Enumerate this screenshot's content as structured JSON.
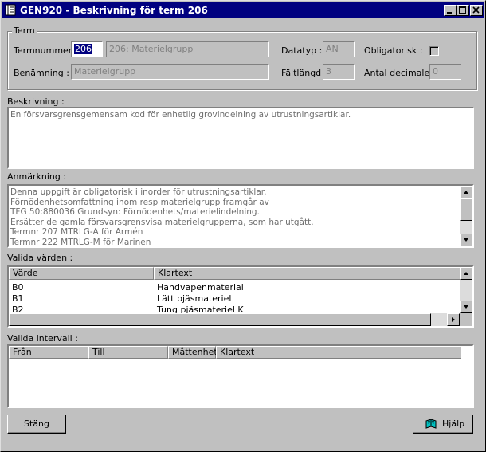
{
  "window": {
    "title": "GEN920 - Beskrivning för term 206"
  },
  "term_group": {
    "legend": "Term",
    "termnummer_label": "Termnummer :",
    "termnummer_value": "206",
    "term_name_value": "206: Materielgrupp",
    "benamning_label": "Benämning :",
    "benamning_value": "Materielgrupp",
    "datatyp_label": "Datatyp :",
    "datatyp_value": "AN",
    "faltlangd_label": "Fältlängd :",
    "faltlangd_value": "3",
    "obligatorisk_label": "Obligatorisk :",
    "obligatorisk_checked": false,
    "antal_decimaler_label": "Antal decimaler :",
    "antal_decimaler_value": "0"
  },
  "beskrivning": {
    "label": "Beskrivning :",
    "text": "En försvarsgrensgemensam kod för enhetlig grovindelning av utrustningsartiklar."
  },
  "anmarkning": {
    "label": "Anmärkning :",
    "lines": [
      "Denna uppgift är obligatorisk i inorder för utrustningsartiklar.",
      "Förnödenhetsomfattning inom resp materielgrupp framgår av",
      "TFG 50:880036 Grundsyn: Förnödenhets/materielindelning.",
      "Ersätter de gamla försvarsgrensvisa materielgrupperna, som har utgått.",
      "Termnr 207 MTRLG-A för Armén",
      "Termnr 222 MTRLG-M för Marinen"
    ]
  },
  "valida_varden": {
    "label": "Valida värden :",
    "columns": [
      "Värde",
      "Klartext"
    ],
    "rows": [
      {
        "varde": "B0",
        "klartext": "Handvapenmaterial"
      },
      {
        "varde": "B1",
        "klartext": "Lätt pjäsmateriel"
      },
      {
        "varde": "B2",
        "klartext": "Tung pjäsmateriel K"
      }
    ]
  },
  "valida_intervall": {
    "label": "Valida intervall :",
    "columns": [
      "Från",
      "Till",
      "Måttenhet",
      "Klartext"
    ]
  },
  "buttons": {
    "stang": "Stäng",
    "hjalp": "Hjälp"
  },
  "colors": {
    "titlebar": "#000080",
    "face": "#c0c0c0",
    "selection": "#000080"
  }
}
